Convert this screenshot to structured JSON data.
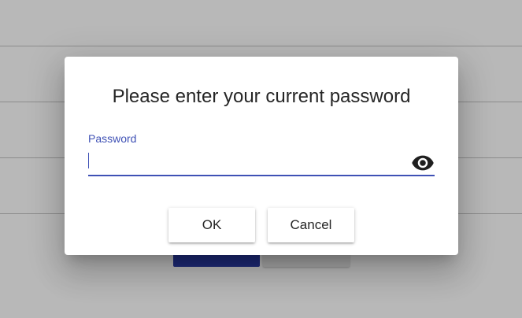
{
  "dialog": {
    "title": "Please enter your current password",
    "password_field": {
      "label": "Password",
      "value": "",
      "type": "password",
      "toggle_icon": "eye-icon"
    },
    "buttons": {
      "ok_label": "OK",
      "cancel_label": "Cancel"
    }
  },
  "colors": {
    "accent": "#3f51b5",
    "backdrop": "#b8b8b8",
    "primary_background_button": "#1e2a78"
  }
}
